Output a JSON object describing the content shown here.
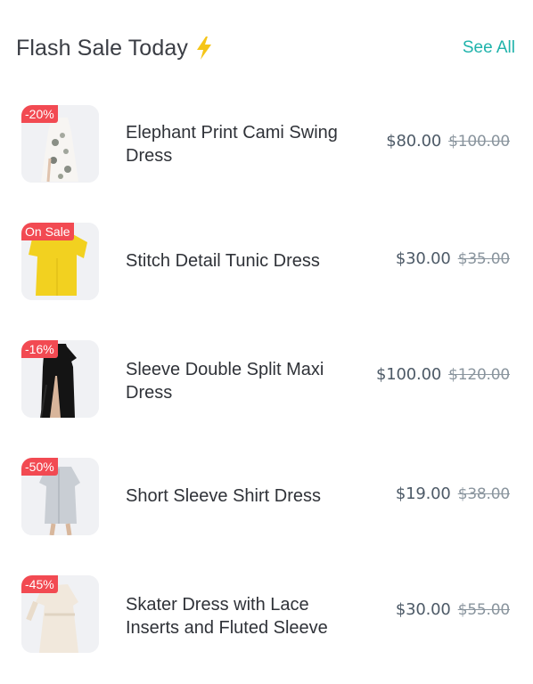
{
  "header": {
    "title": "Flash Sale Today",
    "title_icon": "lightning-bolt-icon",
    "see_all": "See All",
    "accent": "#1fb3ab",
    "bolt_color": "#f5c518"
  },
  "badge_color": "#f24a52",
  "items": [
    {
      "badge": "-20%",
      "name": "Elephant Print Cami Swing Dress",
      "price": "$80.00",
      "old_price": "$100.00",
      "image": "white-printed-dress-image"
    },
    {
      "badge": "On Sale",
      "name": "Stitch Detail Tunic Dress",
      "price": "$30.00",
      "old_price": "$35.00",
      "image": "yellow-tunic-dress-image"
    },
    {
      "badge": "-16%",
      "name": "Sleeve Double Split Maxi Dress",
      "price": "$100.00",
      "old_price": "$120.00",
      "image": "black-maxi-dress-image"
    },
    {
      "badge": "-50%",
      "name": "Short Sleeve Shirt Dress",
      "price": "$19.00",
      "old_price": "$38.00",
      "image": "grey-shirt-dress-image"
    },
    {
      "badge": "-45%",
      "name": "Skater Dress with Lace Inserts and Fluted Sleeve",
      "price": "$30.00",
      "old_price": "$55.00",
      "image": "cream-lace-dress-image"
    }
  ]
}
